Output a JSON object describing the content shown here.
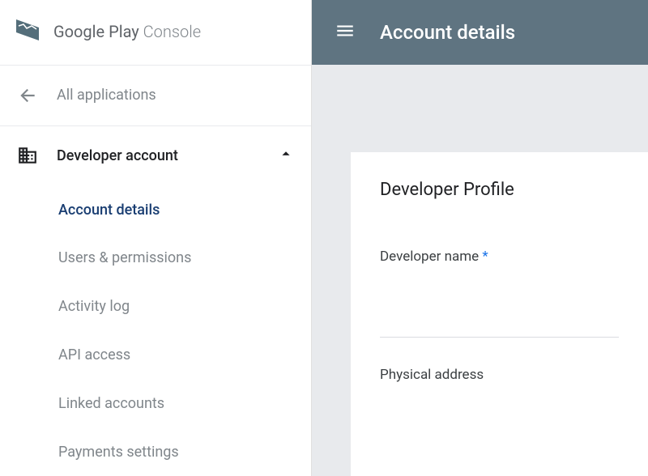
{
  "brand": {
    "strong": "Google Play",
    "light": " Console"
  },
  "sidebar": {
    "all_applications": "All applications",
    "developer_account": "Developer account",
    "items": {
      "account_details": "Account details",
      "users_permissions": "Users & permissions",
      "activity_log": "Activity log",
      "api_access": "API access",
      "linked_accounts": "Linked accounts",
      "payments_settings": "Payments settings"
    }
  },
  "header": {
    "title": "Account details"
  },
  "profile": {
    "card_title": "Developer Profile",
    "developer_name_label": "Developer name",
    "required_marker": "*",
    "developer_name_value": "",
    "physical_address_label": "Physical address"
  }
}
